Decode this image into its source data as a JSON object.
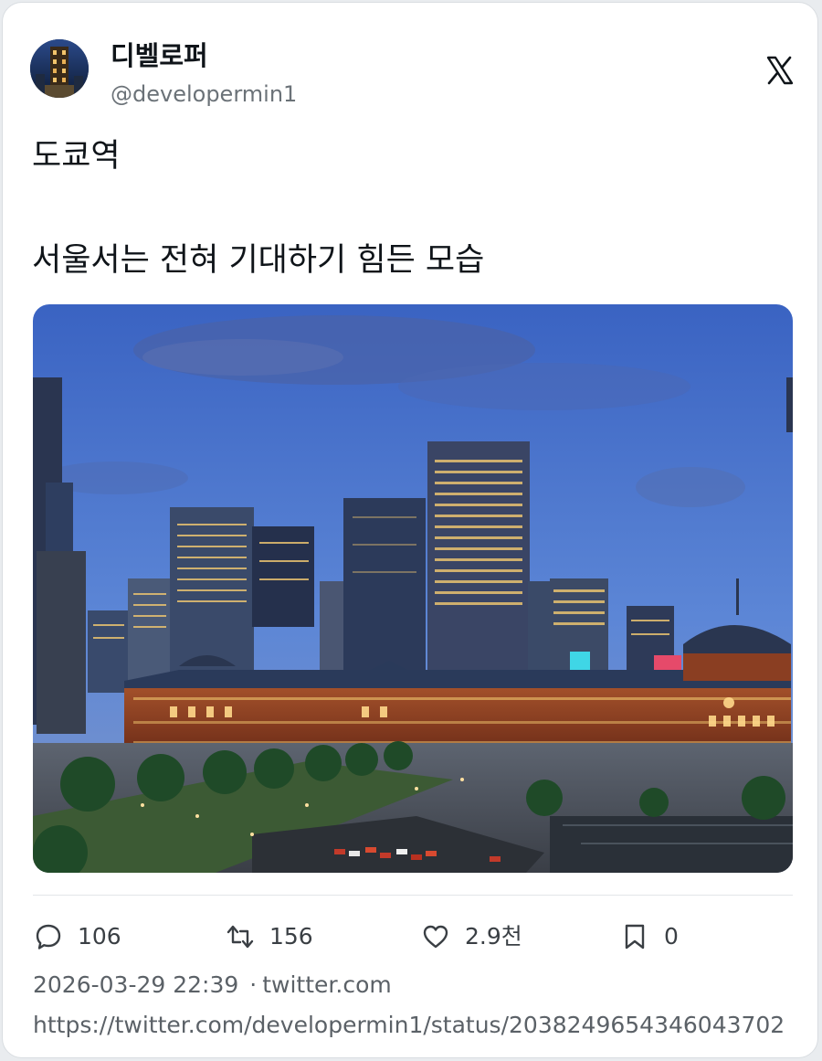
{
  "author": {
    "display_name": "디벨로퍼",
    "handle": "@developermin1",
    "avatar": "night-tower-avatar"
  },
  "brand_icon": "x-logo-icon",
  "tweet": {
    "line1": "도쿄역",
    "line2": "서울서는 전혀 기대하기 힘든 모습",
    "media": "photo of Tokyo Station at dusk with skyscrapers"
  },
  "actions": {
    "replies": "106",
    "retweets": "156",
    "likes": "2.9천",
    "bookmarks": "0"
  },
  "meta": {
    "timestamp": "2026-03-29 22:39",
    "separator": "·",
    "source": "twitter.com"
  },
  "url": "https://twitter.com/developermin1/status/2038249654346043702",
  "colors": {
    "text": "#0f1419",
    "secondary": "#5b6167",
    "sky_top": "#3d68c4",
    "brick": "#8a3b22"
  }
}
